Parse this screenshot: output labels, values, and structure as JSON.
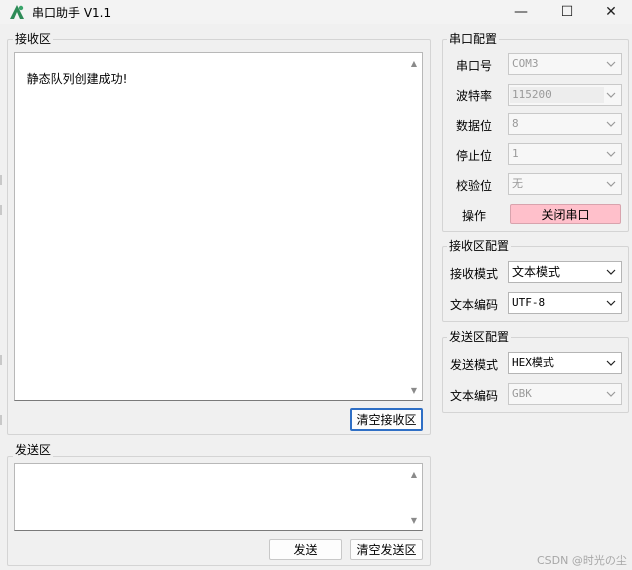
{
  "window": {
    "title": "串口助手 V1.1",
    "minimize_glyph": "—",
    "maximize_glyph": "☐",
    "close_glyph": "✕"
  },
  "receive": {
    "group_title": "接收区",
    "content": "静态队列创建成功!",
    "clear_button": "清空接收区"
  },
  "send": {
    "group_title": "发送区",
    "content": "",
    "send_button": "发送",
    "clear_button": "清空发送区"
  },
  "serial_config": {
    "group_title": "串口配置",
    "port_label": "串口号",
    "port_value": "COM3",
    "baud_label": "波特率",
    "baud_value": "115200",
    "databits_label": "数据位",
    "databits_value": "8",
    "stopbits_label": "停止位",
    "stopbits_value": "1",
    "parity_label": "校验位",
    "parity_value": "无",
    "operation_label": "操作",
    "close_port_button": "关闭串口",
    "close_port_color": "#ffc0cb"
  },
  "receive_config": {
    "group_title": "接收区配置",
    "mode_label": "接收模式",
    "mode_value": "文本模式",
    "encoding_label": "文本编码",
    "encoding_value": "UTF-8"
  },
  "send_config": {
    "group_title": "发送区配置",
    "mode_label": "发送模式",
    "mode_value": "HEX模式",
    "encoding_label": "文本编码",
    "encoding_value": "GBK"
  },
  "watermark": "CSDN @时光の尘",
  "colors": {
    "window_bg": "#f0f0f0",
    "focus_border": "#2f6fc5",
    "app_icon": "#2e8b57"
  }
}
